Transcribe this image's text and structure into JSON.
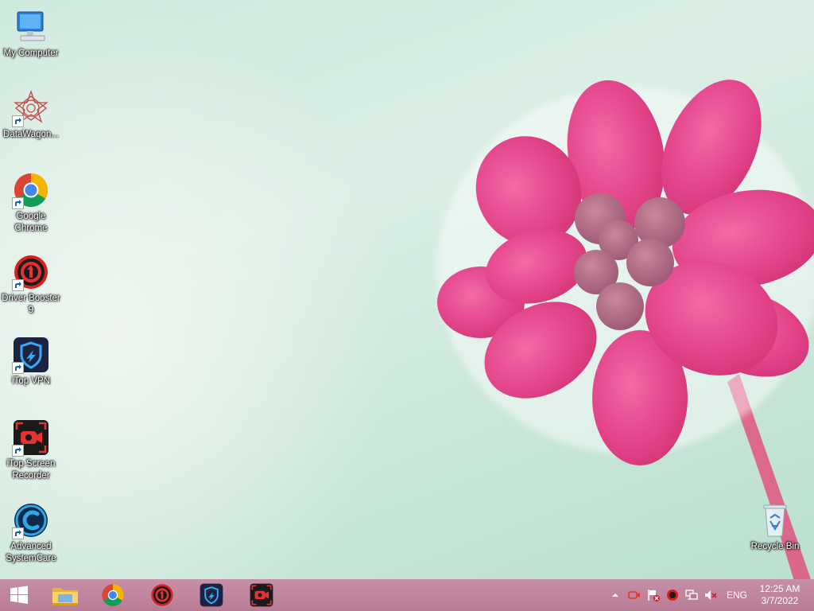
{
  "desktop": {
    "icons": [
      {
        "label": "My Computer",
        "icon": "computer-icon"
      },
      {
        "label": "DataWagon...",
        "icon": "datawagon-icon"
      },
      {
        "label": "Google Chrome",
        "icon": "chrome-icon"
      },
      {
        "label": "Driver Booster 9",
        "icon": "driver-booster-icon"
      },
      {
        "label": "iTop VPN",
        "icon": "itop-vpn-icon"
      },
      {
        "label": "iTop Screen Recorder",
        "icon": "itop-screen-recorder-icon"
      },
      {
        "label": "Advanced SystemCare",
        "icon": "advanced-systemcare-icon"
      },
      {
        "label": "Recycle Bin",
        "icon": "recycle-bin-icon"
      }
    ]
  },
  "taskbar": {
    "pinned": [
      {
        "icon": "windows-start-icon"
      },
      {
        "icon": "file-explorer-icon"
      },
      {
        "icon": "chrome-icon"
      },
      {
        "icon": "driver-booster-icon"
      },
      {
        "icon": "itop-vpn-icon"
      },
      {
        "icon": "itop-screen-recorder-icon"
      }
    ],
    "tray": {
      "language": "ENG",
      "time": "12:25 AM",
      "date": "3/7/2022"
    }
  },
  "colors": {
    "taskbar": "#c78fa8",
    "flower": "#e8408a"
  }
}
